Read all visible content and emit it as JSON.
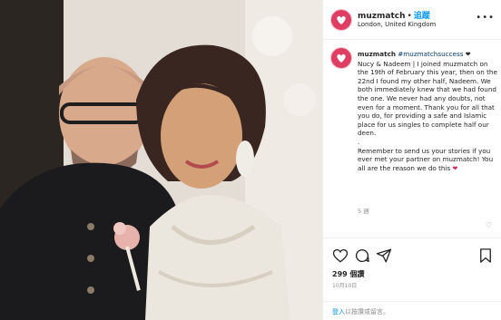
{
  "post": {
    "username": "muzmatch",
    "follow_label": "追蹤",
    "location": "London, United Kingdom",
    "more_icon": "more-icon",
    "caption_username": "muzmatch",
    "caption_hashtag": "#muzmatchsuccess",
    "caption_body": "Nucy & Nadeem | I joined muzmatch on the 19th of February this year, then on the 22nd I found my other half, Nadeem. We both immediately knew that we had found the one. We never had any doubts, not even for a moment. Thank you for all that you do, for providing a safe and Islamic place for us singles to complete half our deen.\n.\nRemember to send us your stories if you ever met your partner on muzmatch! You all are the reason we do this",
    "relative_time": "5 週",
    "likes_count": "299",
    "likes_label": "個讚",
    "date": "10月10日",
    "login_link": "登入",
    "login_text": "以按讚或留言。"
  },
  "icons": [
    "heart-icon",
    "comment-icon",
    "share-icon",
    "bookmark-icon"
  ],
  "colors": {
    "brand": "#e03d62",
    "link": "#0095f6",
    "muted": "#8e8e8e"
  }
}
